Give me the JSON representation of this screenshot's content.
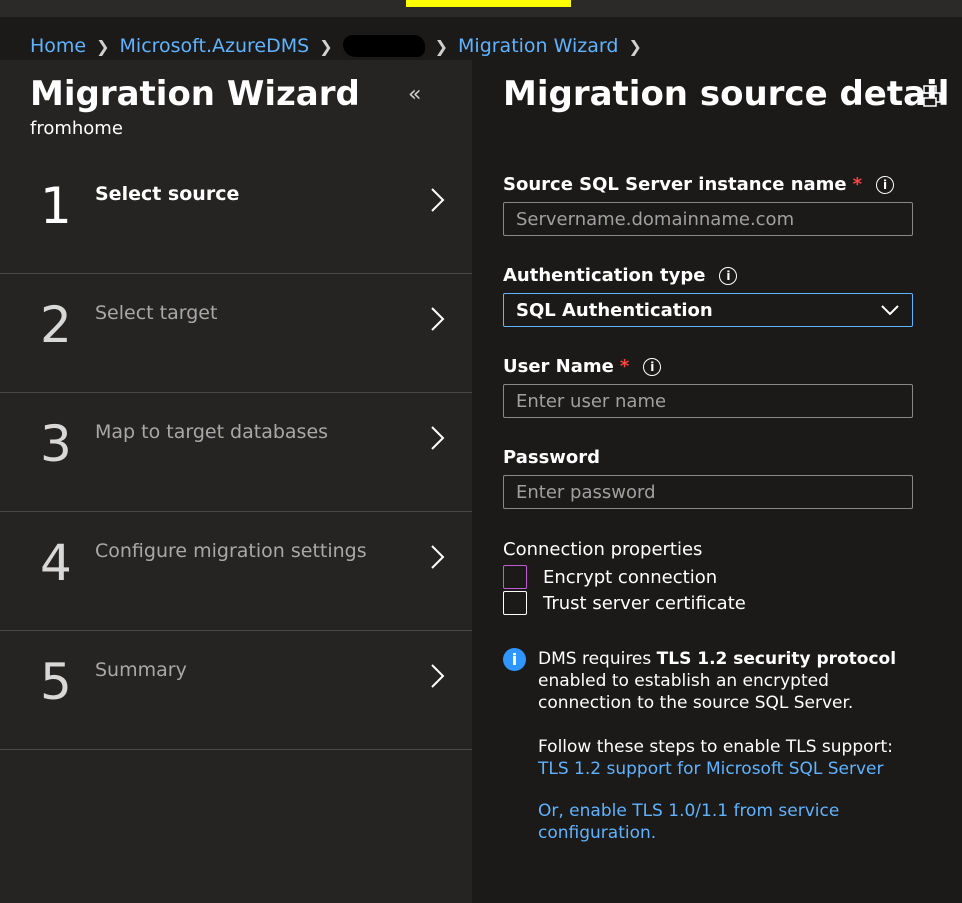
{
  "breadcrumb": {
    "home": "Home",
    "service": "Microsoft.AzureDMS",
    "current": "Migration Wizard"
  },
  "wizard": {
    "title": "Migration Wizard",
    "subtitle": "fromhome",
    "collapse_icon": "double-chevron-left",
    "steps": [
      {
        "number": "1",
        "label": "Select source",
        "active": true
      },
      {
        "number": "2",
        "label": "Select target",
        "active": false
      },
      {
        "number": "3",
        "label": "Map to target databases",
        "active": false
      },
      {
        "number": "4",
        "label": "Configure migration settings",
        "active": false
      },
      {
        "number": "5",
        "label": "Summary",
        "active": false
      }
    ]
  },
  "detail": {
    "title": "Migration source detail",
    "print_icon": "printer",
    "source_label": "Source SQL Server instance name",
    "source_placeholder": "Servername.domainname.com",
    "auth_label": "Authentication type",
    "auth_value": "SQL Authentication",
    "user_label": "User Name",
    "user_placeholder": "Enter user name",
    "password_label": "Password",
    "password_placeholder": "Enter password",
    "connection_label": "Connection properties",
    "encrypt_label": "Encrypt connection",
    "encrypt_checked": false,
    "trust_label": "Trust server certificate",
    "trust_checked": false,
    "required_mark": "*",
    "info_glyph": "i"
  },
  "notice": {
    "text_pre": "DMS requires ",
    "text_bold": "TLS 1.2 security protocol",
    "text_post": " enabled to establish an encrypted connection to the source SQL Server.",
    "steps_text": "Follow these steps to enable TLS support:",
    "link1": "TLS 1.2 support for Microsoft SQL Server",
    "link2": "Or, enable TLS 1.0/1.1 from service configuration."
  },
  "colors": {
    "accent": "#5fb3ff",
    "required": "#ff4343",
    "info": "#2f96ff",
    "focus": "#c15bd6",
    "highlight": "#ffff00"
  }
}
